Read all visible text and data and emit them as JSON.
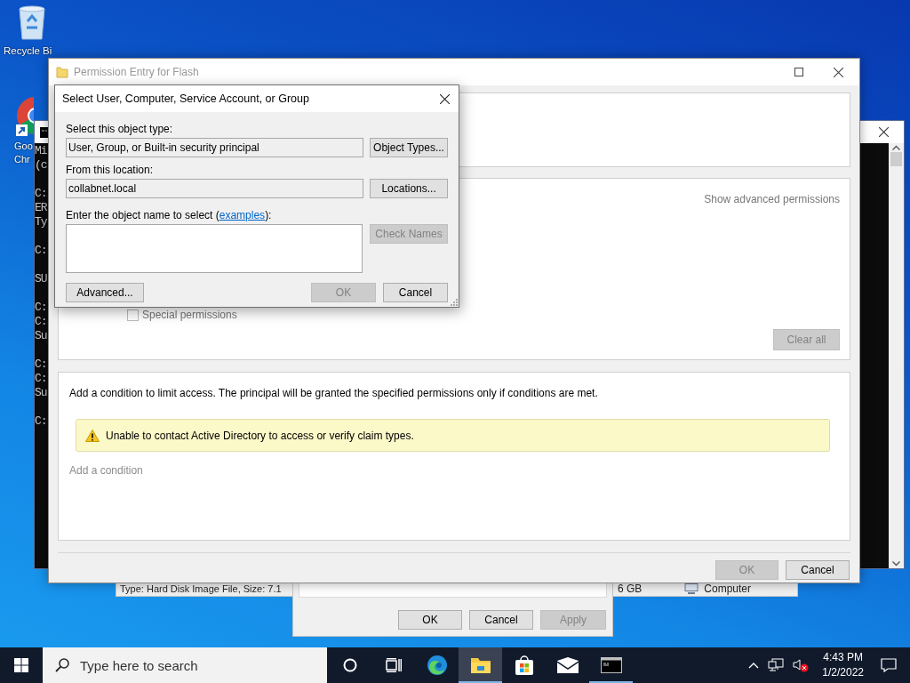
{
  "desktop_icons": [
    {
      "kind": "recycle_bin",
      "label": "Recycle Bi"
    },
    {
      "kind": "chrome",
      "label": "Goo Chr"
    }
  ],
  "console": {
    "blocks": [
      [
        "Mi",
        "(c"
      ],
      [
        "C:",
        "ER",
        "Ty"
      ],
      [
        "C:"
      ],
      [
        "SU"
      ],
      [
        "C:",
        "C:",
        "Su"
      ],
      [
        "C:",
        "C:",
        "Su"
      ],
      [
        "C:"
      ]
    ]
  },
  "explorer_status": {
    "details": "Type: Hard Disk Image File, Size: 7.1",
    "size": "6 GB",
    "location": "Computer"
  },
  "properties_dialog": {
    "buttons": [
      {
        "label": "OK",
        "disabled": false
      },
      {
        "label": "Cancel",
        "disabled": false
      },
      {
        "label": "Apply",
        "disabled": true
      }
    ]
  },
  "permission_entry": {
    "title": "Permission Entry for Flash",
    "show_advanced": "Show advanced permissions",
    "special_permissions": {
      "label": "Special permissions",
      "checked": false
    },
    "clear_all": {
      "label": "Clear all",
      "disabled": true
    },
    "condition_text": "Add a condition to limit access. The principal will be granted the specified permissions only if conditions are met.",
    "warning": "Unable to contact Active Directory to access or verify claim types.",
    "add_condition": "Add a condition",
    "buttons": [
      {
        "label": "OK",
        "disabled": true
      },
      {
        "label": "Cancel",
        "disabled": false
      }
    ]
  },
  "select_dialog": {
    "title": "Select User, Computer, Service Account, or Group",
    "object_type_label": "Select this object type:",
    "object_type": "User, Group, or Built-in security principal",
    "object_types_button": {
      "label": "Object Types...",
      "disabled": false
    },
    "location_label": "From this location:",
    "location": "collabnet.local",
    "locations_button": {
      "label": "Locations...",
      "disabled": false
    },
    "name_prompt": "Enter the object name to select (",
    "examples_link": "examples",
    "name_prompt_end": "):",
    "check_names_button": {
      "label": "Check Names",
      "disabled": true
    },
    "advanced_button": {
      "label": "Advanced...",
      "disabled": false
    },
    "ok_button": {
      "label": "OK",
      "disabled": true
    },
    "cancel_button": {
      "label": "Cancel",
      "disabled": false
    }
  },
  "taskbar": {
    "search_placeholder": "Type here to search",
    "apps": [
      {
        "kind": "cortana",
        "active": false,
        "running": false
      },
      {
        "kind": "task_view",
        "active": false,
        "running": false
      },
      {
        "kind": "edge",
        "active": false,
        "running": false
      },
      {
        "kind": "explorer",
        "active": true,
        "running": true
      },
      {
        "kind": "store",
        "active": false,
        "running": false
      },
      {
        "kind": "mail",
        "active": false,
        "running": false
      },
      {
        "kind": "terminal",
        "active": false,
        "running": true
      }
    ],
    "time": "4:43 PM",
    "date": "1/2/2022"
  }
}
